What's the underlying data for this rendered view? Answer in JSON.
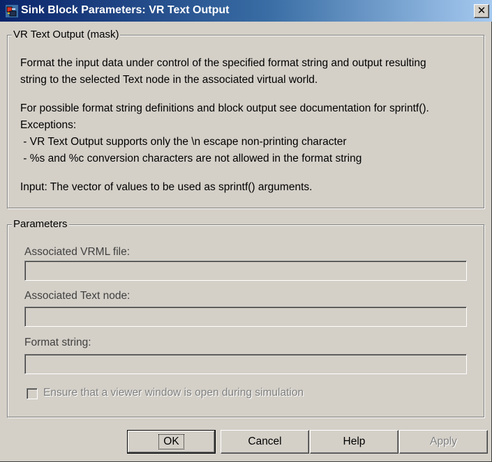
{
  "window": {
    "title": "Sink Block Parameters: VR Text Output",
    "close_glyph": "✕"
  },
  "mask_group": {
    "legend": "VR Text Output (mask)",
    "lines": [
      "Format the input data under control of the specified format string and output resulting",
      "string to the selected Text node in the associated virtual world.",
      "For possible format string definitions and block output see documentation for sprintf().",
      "Exceptions:",
      " - VR Text Output supports only the \\n escape non-printing character",
      " - %s and %c conversion characters are not allowed in the format string",
      "Input: The vector of values to be used as sprintf() arguments."
    ]
  },
  "params_group": {
    "legend": "Parameters",
    "vrml_label": "Associated VRML file:",
    "vrml_value": "",
    "textnode_label": "Associated Text node:",
    "textnode_value": "",
    "format_label": "Format string:",
    "format_value": "",
    "viewer_checkbox_label": "Ensure that a viewer window is open during simulation",
    "viewer_checkbox_checked": false
  },
  "buttons": {
    "ok": "OK",
    "cancel": "Cancel",
    "help": "Help",
    "apply": "Apply"
  },
  "colors": {
    "titlebar_start": "#0a246a",
    "titlebar_end": "#a6caf0",
    "face": "#d4d0c8"
  }
}
